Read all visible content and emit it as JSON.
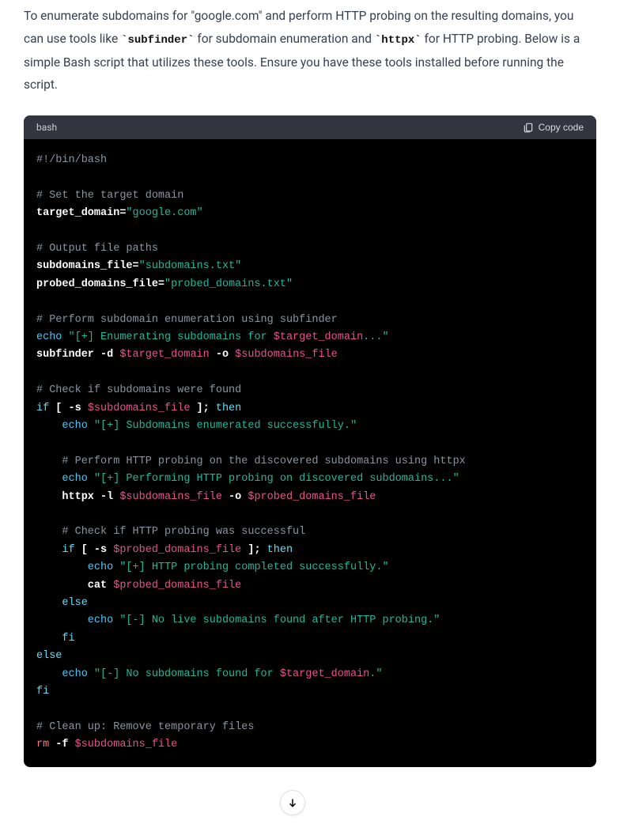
{
  "intro": {
    "part1": "To enumerate subdomains for \"google.com\" and perform HTTP probing on the resulting domains, you can use tools like ",
    "code1": "`subfinder`",
    "part2": " for subdomain enumeration and ",
    "code2": "`httpx`",
    "part3": " for HTTP probing. Below is a simple Bash script that utilizes these tools. Ensure you have these tools installed before running the script."
  },
  "code_block": {
    "language": "bash",
    "copy_label": "Copy code"
  },
  "code": {
    "l1": "#!/bin/bash",
    "l2": "# Set the target domain",
    "l3a": "target_domain=",
    "l3b": "\"google.com\"",
    "l4": "# Output file paths",
    "l5a": "subdomains_file=",
    "l5b": "\"subdomains.txt\"",
    "l6a": "probed_domains_file=",
    "l6b": "\"probed_domains.txt\"",
    "l7": "# Perform subdomain enumeration using subfinder",
    "l8a": "echo",
    "l8b": " \"[+] Enumerating subdomains for ",
    "l8c": "$target_domain",
    "l8d": "...\"",
    "l9a": "subfinder -d ",
    "l9b": "$target_domain",
    "l9c": " -o ",
    "l9d": "$subdomains_file",
    "l10": "# Check if subdomains were found",
    "l11a": "if",
    "l11b": " [ -s ",
    "l11c": "$subdomains_file",
    "l11d": " ]; ",
    "l11e": "then",
    "l12a": "    echo",
    "l12b": " \"[+] Subdomains enumerated successfully.\"",
    "l13": "    # Perform HTTP probing on the discovered subdomains using httpx",
    "l14a": "    echo",
    "l14b": " \"[+] Performing HTTP probing on discovered subdomains...\"",
    "l15a": "    httpx -l ",
    "l15b": "$subdomains_file",
    "l15c": " -o ",
    "l15d": "$probed_domains_file",
    "l16": "    # Check if HTTP probing was successful",
    "l17a": "    if",
    "l17b": " [ -s ",
    "l17c": "$probed_domains_file",
    "l17d": " ]; ",
    "l17e": "then",
    "l18a": "        echo",
    "l18b": " \"[+] HTTP probing completed successfully.\"",
    "l19a": "        cat ",
    "l19b": "$probed_domains_file",
    "l20": "    else",
    "l21a": "        echo",
    "l21b": " \"[-] No live subdomains found after HTTP probing.\"",
    "l22": "    fi",
    "l23": "else",
    "l24a": "    echo",
    "l24b": " \"[-] No subdomains found for ",
    "l24c": "$target_domain",
    "l24d": ".\"",
    "l25": "fi",
    "l26": "# Clean up: Remove temporary files",
    "l27a": "rm",
    "l27b": " -f ",
    "l27c": "$subdomains_file"
  }
}
